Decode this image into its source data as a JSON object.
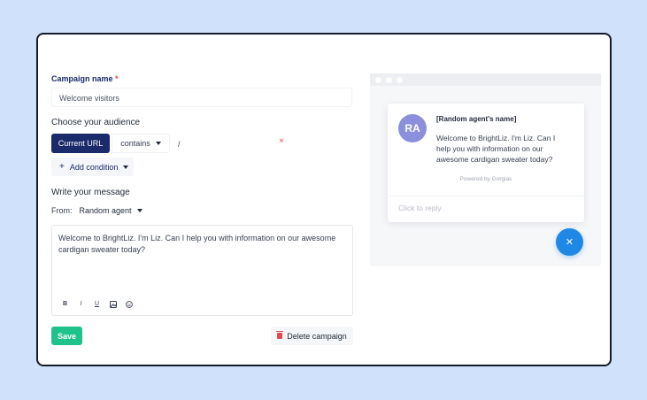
{
  "form": {
    "campaign_name_label": "Campaign name",
    "required_mark": "*",
    "campaign_name_value": "Welcome visitors",
    "audience_title": "Choose your audience",
    "url_button": "Current URL",
    "operator": "contains",
    "url_value": "/",
    "remove_icon": "×",
    "add_condition_icon": "+",
    "add_condition": "Add condition",
    "message_title": "Write your message",
    "from_label": "From:",
    "from_value": "Random agent",
    "message_text": "Welcome to BrightLiz. I'm Liz. Can I help you with information on our awesome cardigan sweater today?",
    "toolbar": {
      "bold": "B",
      "italic": "I",
      "underline": "U"
    },
    "save": "Save",
    "delete": "Delete campaign"
  },
  "preview": {
    "avatar_initials": "RA",
    "agent_name": "[Random agent's name]",
    "message": "Welcome to BrightLiz. I'm Liz. Can I help you with information on our awesome cardigan sweater today?",
    "powered_by": "Powered by Gorgias",
    "reply_placeholder": "Click to reply",
    "close_icon": "✕"
  },
  "colors": {
    "background": "#cfe1fb",
    "primary": "#1b2a6b",
    "save": "#1fc28b",
    "danger": "#e5484d",
    "avatar": "#8b8fdc",
    "chat_button": "#1f87e5"
  }
}
